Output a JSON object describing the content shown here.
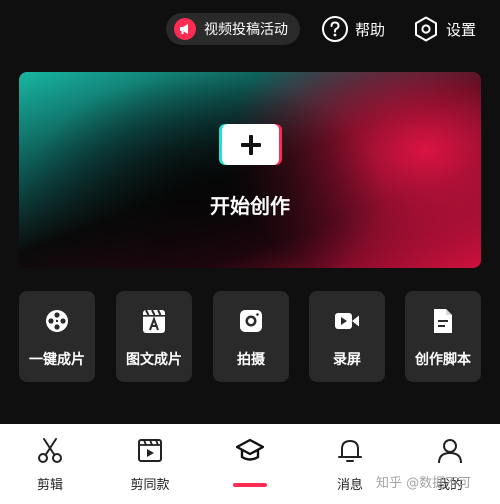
{
  "top_bar": {
    "campaign_label": "视频投稿活动",
    "help_label": "帮助",
    "settings_label": "设置"
  },
  "hero": {
    "label": "开始创作"
  },
  "tools": [
    {
      "label": "一键成片",
      "icon": "film-reel-icon"
    },
    {
      "label": "图文成片",
      "icon": "text-to-video-icon"
    },
    {
      "label": "拍摄",
      "icon": "camera-icon"
    },
    {
      "label": "录屏",
      "icon": "screen-record-icon"
    },
    {
      "label": "创作脚本",
      "icon": "script-document-icon"
    }
  ],
  "bottom_nav": {
    "items": [
      {
        "label": "剪辑",
        "icon": "scissors-icon"
      },
      {
        "label": "剪同款",
        "icon": "template-icon"
      },
      {
        "label": "",
        "icon": "graduation-cap-icon",
        "selected": true
      },
      {
        "label": "消息",
        "icon": "bell-icon"
      },
      {
        "label": "我的",
        "icon": "profile-icon"
      }
    ]
  },
  "watermark": "知乎 @数据不可",
  "colors": {
    "accent": "#fe2c55",
    "cyan_accent": "#21e0d3",
    "background": "#0f0f0f",
    "tile": "#2a2a2a"
  }
}
